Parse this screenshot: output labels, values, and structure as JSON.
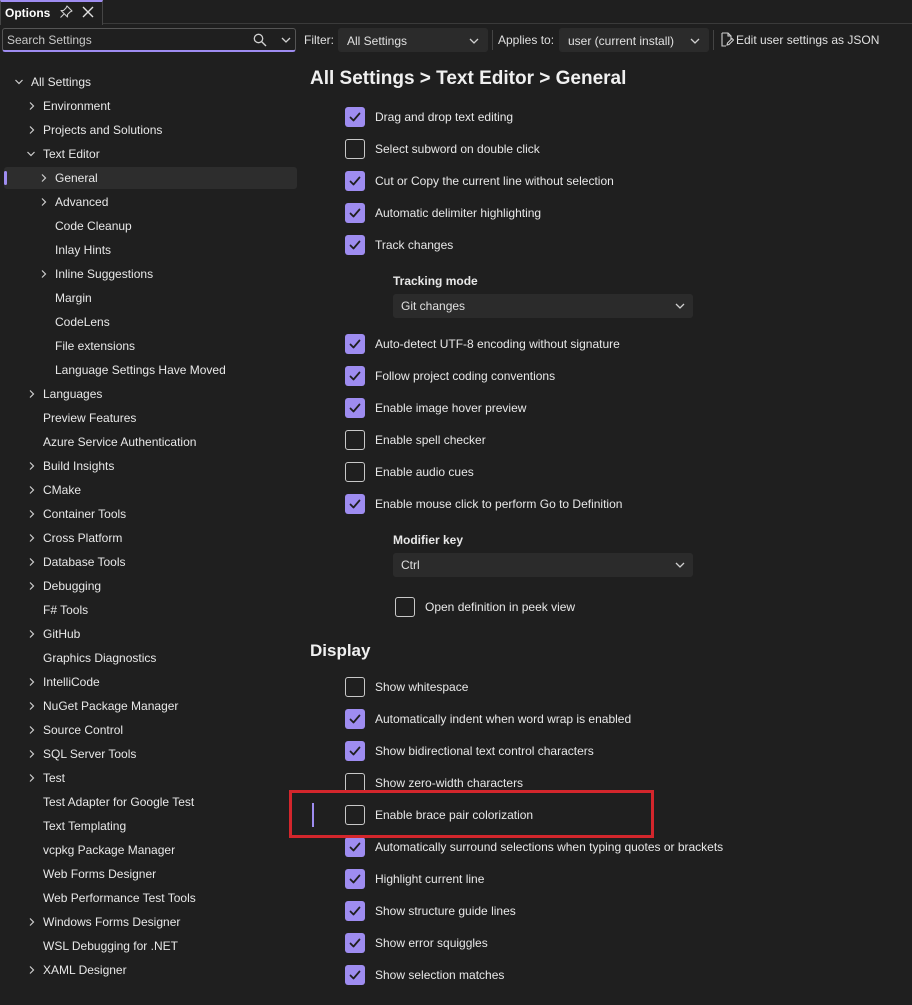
{
  "window": {
    "tab_title": "Options"
  },
  "toolbar": {
    "search_placeholder": "Search Settings",
    "filter_label": "Filter:",
    "filter_value": "All Settings",
    "applies_label": "Applies to:",
    "applies_value": "user (current install)",
    "json_label": "Edit user settings as JSON"
  },
  "tree": {
    "root": "All Settings",
    "items": [
      {
        "label": "Environment"
      },
      {
        "label": "Projects and Solutions"
      },
      {
        "label": "Text Editor"
      },
      {
        "label": "General"
      },
      {
        "label": "Advanced"
      },
      {
        "label": "Code Cleanup"
      },
      {
        "label": "Inlay Hints"
      },
      {
        "label": "Inline Suggestions"
      },
      {
        "label": "Margin"
      },
      {
        "label": "CodeLens"
      },
      {
        "label": "File extensions"
      },
      {
        "label": "Language Settings Have Moved"
      },
      {
        "label": "Languages"
      },
      {
        "label": "Preview Features"
      },
      {
        "label": "Azure Service Authentication"
      },
      {
        "label": "Build Insights"
      },
      {
        "label": "CMake"
      },
      {
        "label": "Container Tools"
      },
      {
        "label": "Cross Platform"
      },
      {
        "label": "Database Tools"
      },
      {
        "label": "Debugging"
      },
      {
        "label": "F# Tools"
      },
      {
        "label": "GitHub"
      },
      {
        "label": "Graphics Diagnostics"
      },
      {
        "label": "IntelliCode"
      },
      {
        "label": "NuGet Package Manager"
      },
      {
        "label": "Source Control"
      },
      {
        "label": "SQL Server Tools"
      },
      {
        "label": "Test"
      },
      {
        "label": "Test Adapter for Google Test"
      },
      {
        "label": "Text Templating"
      },
      {
        "label": "vcpkg Package Manager"
      },
      {
        "label": "Web Forms Designer"
      },
      {
        "label": "Web Performance Test Tools"
      },
      {
        "label": "Windows Forms Designer"
      },
      {
        "label": "WSL Debugging for .NET"
      },
      {
        "label": "XAML Designer"
      }
    ]
  },
  "main": {
    "breadcrumb": "All Settings > Text Editor > General",
    "general": {
      "options": [
        {
          "label": "Drag and drop text editing",
          "checked": true
        },
        {
          "label": "Select subword on double click",
          "checked": false
        },
        {
          "label": "Cut or Copy the current line without selection",
          "checked": true
        },
        {
          "label": "Automatic delimiter highlighting",
          "checked": true
        },
        {
          "label": "Track changes",
          "checked": true
        },
        {
          "label": "Auto-detect UTF-8 encoding without signature",
          "checked": true
        },
        {
          "label": "Follow project coding conventions",
          "checked": true
        },
        {
          "label": "Enable image hover preview",
          "checked": true
        },
        {
          "label": "Enable spell checker",
          "checked": false
        },
        {
          "label": "Enable audio cues",
          "checked": false
        },
        {
          "label": "Enable mouse click to perform Go to Definition",
          "checked": true
        }
      ],
      "tracking_mode_label": "Tracking mode",
      "tracking_mode_value": "Git changes",
      "modifier_key_label": "Modifier key",
      "modifier_key_value": "Ctrl",
      "peek_label": "Open definition in peek view",
      "peek_checked": false
    },
    "display": {
      "title": "Display",
      "options": [
        {
          "label": "Show whitespace",
          "checked": false
        },
        {
          "label": "Automatically indent when word wrap is enabled",
          "checked": true
        },
        {
          "label": "Show bidirectional text control characters",
          "checked": true
        },
        {
          "label": "Show zero-width characters",
          "checked": false
        },
        {
          "label": "Enable brace pair colorization",
          "checked": false
        },
        {
          "label": "Automatically surround selections when typing quotes or brackets",
          "checked": true
        },
        {
          "label": "Highlight current line",
          "checked": true
        },
        {
          "label": "Show structure guide lines",
          "checked": true
        },
        {
          "label": "Show error squiggles",
          "checked": true
        },
        {
          "label": "Show selection matches",
          "checked": true
        }
      ]
    }
  },
  "colors": {
    "accent": "#9e8cf0",
    "background": "#1f1f1f",
    "highlight_box": "#d3262c"
  }
}
